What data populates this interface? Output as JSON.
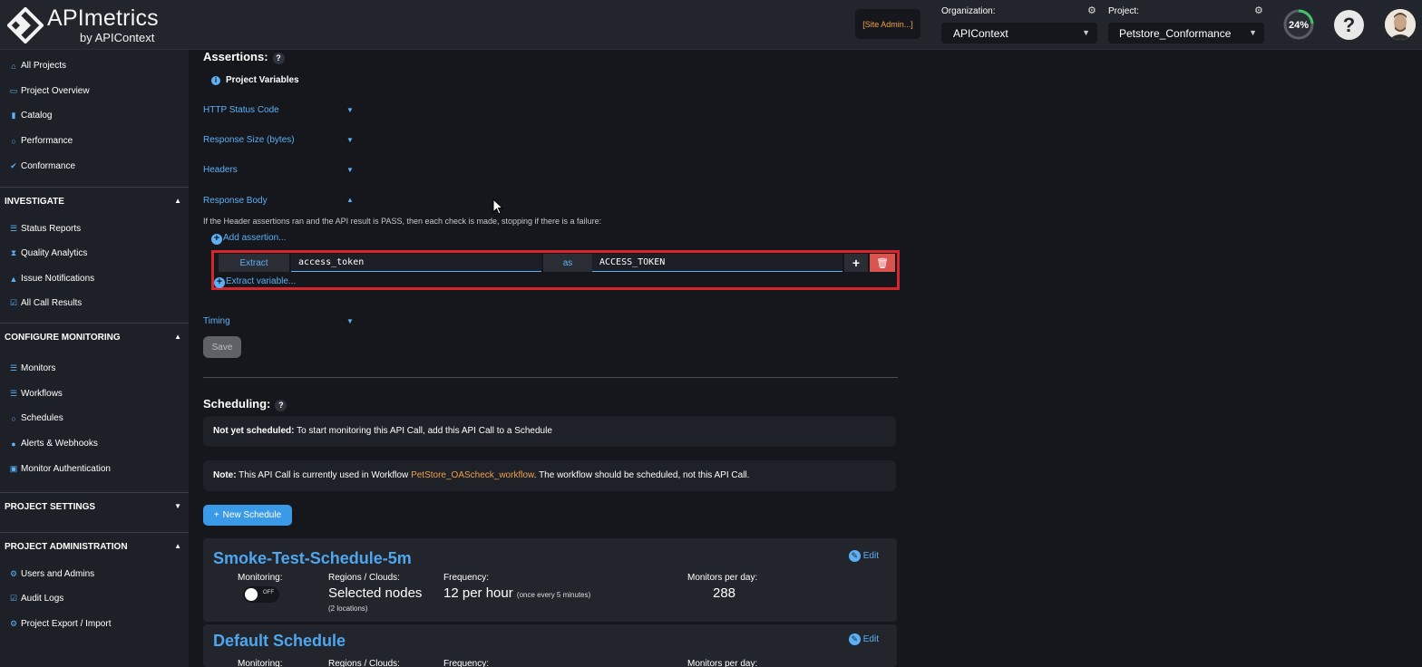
{
  "header": {
    "brand": "APImetrics",
    "brand_sub": "by APIContext",
    "site_admin": "[Site Admin...]",
    "org_label": "Organization:",
    "org_value": "APIContext",
    "project_label": "Project:",
    "project_value": "Petstore_Conformance",
    "progress_text": "24%",
    "progress_value": 0.24,
    "help": "?"
  },
  "sidebar": {
    "top_items": [
      {
        "label": "All Projects",
        "icon": "home-icon"
      },
      {
        "label": "Project Overview",
        "icon": "folder-icon"
      },
      {
        "label": "Catalog",
        "icon": "book-icon"
      },
      {
        "label": "Performance",
        "icon": "gauge-icon"
      },
      {
        "label": "Conformance",
        "icon": "check-icon"
      }
    ],
    "investigate": {
      "title": "INVESTIGATE",
      "items": [
        "Status Reports",
        "Quality Analytics",
        "Issue Notifications",
        "All Call Results"
      ]
    },
    "configure": {
      "title": "CONFIGURE MONITORING",
      "items": [
        "Monitors",
        "Workflows",
        "Schedules",
        "Alerts & Webhooks",
        "Monitor Authentication"
      ]
    },
    "project_settings": {
      "title": "PROJECT SETTINGS"
    },
    "administration": {
      "title": "PROJECT ADMINISTRATION",
      "items": [
        "Users and Admins",
        "Audit Logs",
        "Project Export / Import"
      ]
    }
  },
  "assertions": {
    "title": "Assertions:",
    "project_variables": "Project Variables",
    "sections": [
      "HTTP Status Code",
      "Response Size (bytes)",
      "Headers",
      "Response Body"
    ],
    "info_text": "If the Header assertions ran and the API result is PASS, then each check is made, stopping if there is a failure:",
    "add_assertion": "Add assertion...",
    "extract_label": "Extract",
    "extract_value": "access_token",
    "as_label": "as",
    "variable_value": "ACCESS_TOKEN",
    "extract_variable": "Extract variable...",
    "timing": "Timing",
    "save": "Save"
  },
  "scheduling": {
    "title": "Scheduling:",
    "not_scheduled_bold": "Not yet scheduled:",
    "not_scheduled_text": "To start monitoring this API Call, add this API Call to a Schedule",
    "note_bold": "Note:",
    "note_text": "This API Call is currently used in Workflow",
    "note_workflow": "PetStore_OAScheck_workflow",
    "note_tail": ". The workflow should be scheduled, not this API Call.",
    "new_schedule": "New Schedule",
    "schedules": [
      {
        "name": "Smoke-Test-Schedule-5m",
        "edit": "Edit",
        "monitoring_label": "Monitoring:",
        "monitoring_state": "OFF",
        "regions_label": "Regions / Clouds:",
        "regions_value": "Selected nodes",
        "regions_sub": "(2 locations)",
        "frequency_label": "Frequency:",
        "frequency_value": "12 per hour",
        "frequency_sub": "(once every 5 minutes)",
        "mpd_label": "Monitors per day:",
        "mpd_value": "288"
      },
      {
        "name": "Default Schedule",
        "edit": "Edit",
        "monitoring_label": "Monitoring:",
        "regions_label": "Regions / Clouds:",
        "frequency_label": "Frequency:",
        "mpd_label": "Monitors per day:"
      }
    ]
  }
}
